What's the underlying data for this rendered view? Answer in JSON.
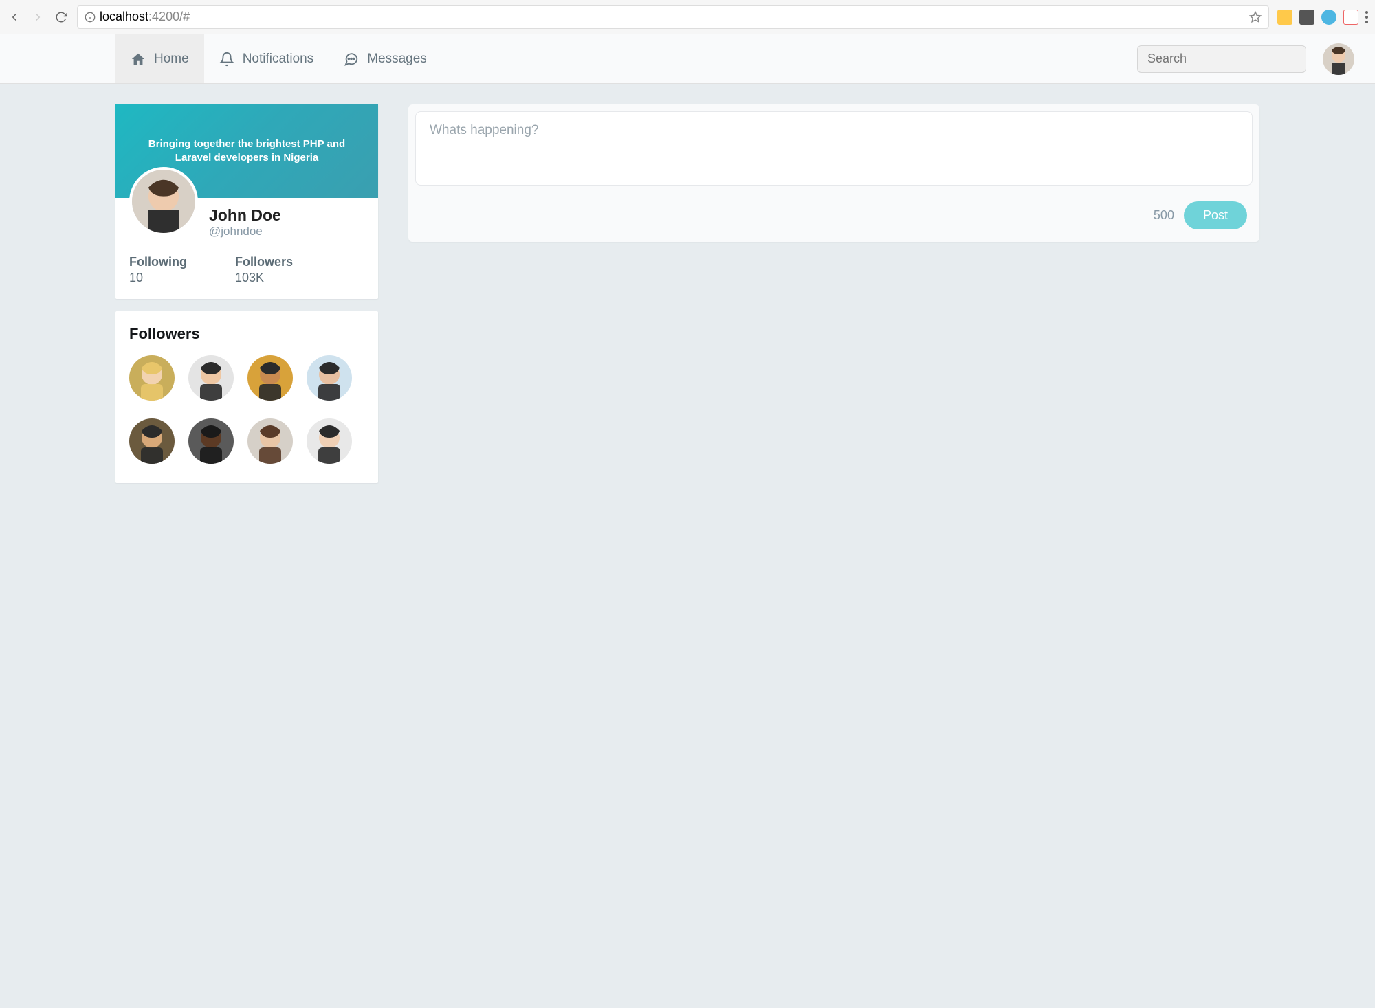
{
  "browser": {
    "url_host": "localhost",
    "url_port_path": ":4200/#"
  },
  "nav": {
    "items": [
      {
        "label": "Home",
        "icon": "home-icon",
        "active": true
      },
      {
        "label": "Notifications",
        "icon": "bell-icon",
        "active": false
      },
      {
        "label": "Messages",
        "icon": "chat-icon",
        "active": false
      }
    ],
    "search_placeholder": "Search"
  },
  "profile": {
    "cover_text": "Bringing together the brightest PHP and Laravel developers in Nigeria",
    "display_name": "John Doe",
    "handle": "@johndoe",
    "stats": {
      "following_label": "Following",
      "following_value": "10",
      "followers_label": "Followers",
      "followers_value": "103K"
    }
  },
  "followers_card": {
    "title": "Followers",
    "avatars": [
      {
        "bg": "#c9ae5b",
        "skin": "#f2d3b0",
        "hair": "#e8c66a"
      },
      {
        "bg": "#e4e4e4",
        "skin": "#eec7a3",
        "hair": "#2b2b2b"
      },
      {
        "bg": "#d8a23a",
        "skin": "#c98a50",
        "hair": "#2b2b2b"
      },
      {
        "bg": "#cfe2ee",
        "skin": "#e7bfa0",
        "hair": "#2b2b2b"
      },
      {
        "bg": "#6b5a3e",
        "skin": "#d8a878",
        "hair": "#2b2b2b"
      },
      {
        "bg": "#5a5a5a",
        "skin": "#5c3a24",
        "hair": "#1a1a1a"
      },
      {
        "bg": "#d6d0c8",
        "skin": "#e9c6a6",
        "hair": "#5a3b28"
      },
      {
        "bg": "#e8e8e8",
        "skin": "#f0d0b5",
        "hair": "#2b2b2b"
      }
    ]
  },
  "composer": {
    "placeholder": "Whats happening?",
    "char_count": "500",
    "post_label": "Post"
  }
}
